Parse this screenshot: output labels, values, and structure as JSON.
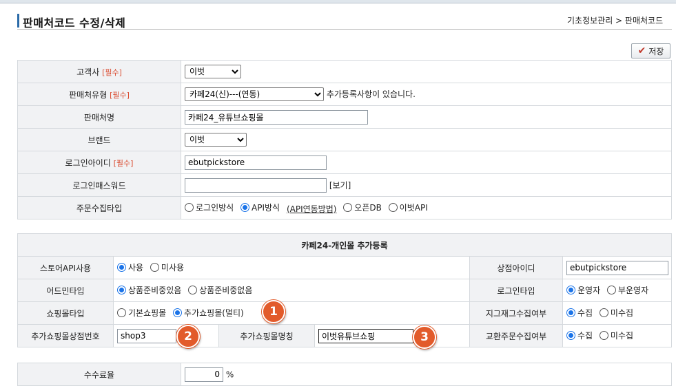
{
  "header": {
    "title": "판매처코드 수정/삭제",
    "breadcrumb": "기초정보관리 > 판매처코드"
  },
  "toolbar": {
    "save_label": "저장"
  },
  "required_tag": "[필수]",
  "form": {
    "customer_label": "고객사",
    "customer_value": "이벗",
    "channel_type_label": "판매처유형",
    "channel_type_value": "카페24(신)---(연동)",
    "channel_type_note": "추가등록사항이 있습니다.",
    "channel_name_label": "판매처명",
    "channel_name_value": "카페24_유튜브쇼핑몰",
    "brand_label": "브랜드",
    "brand_value": "이벗",
    "login_id_label": "로그인아이디",
    "login_id_value": "ebutpickstore",
    "login_pw_label": "로그인패스워드",
    "login_pw_value": "",
    "view_label": "[보기]",
    "order_type_label": "주문수집타입",
    "order_type_options": [
      "로그인방식",
      "API방식",
      "(API연동방법)",
      "오픈DB",
      "이벗API"
    ],
    "order_type_selected": "API방식"
  },
  "extra": {
    "section_title": "카페24-개인몰 추가등록",
    "store_api_label": "스토어API사용",
    "store_api_options": [
      "사용",
      "미사용"
    ],
    "store_api_selected": "사용",
    "shop_id_label": "상점아이디",
    "shop_id_value": "ebutpickstore",
    "admin_type_label": "어드민타입",
    "admin_type_options": [
      "상품준비중있음",
      "상품준비중없음"
    ],
    "admin_type_selected": "상품준비중있음",
    "login_type_label": "로그인타입",
    "login_type_options": [
      "운영자",
      "부운영자"
    ],
    "login_type_selected": "운영자",
    "mall_type_label": "쇼핑몰타입",
    "mall_type_options": [
      "기본쇼핑몰",
      "추가쇼핑몰(멀티)"
    ],
    "mall_type_selected": "추가쇼핑몰(멀티)",
    "stock_label": "지그재그수집여부",
    "stock_options": [
      "수집",
      "미수집"
    ],
    "stock_selected": "수집",
    "extra_shop_no_label": "추가쇼핑몰상점번호",
    "extra_shop_no_value": "shop3",
    "extra_shop_name_label": "추가쇼핑몰명칭",
    "extra_shop_name_value": "이벗유튜브쇼핑",
    "exchange_label": "교환주문수집여부",
    "exchange_options": [
      "수집",
      "미수집"
    ],
    "exchange_selected": "수집"
  },
  "fee": {
    "label": "수수료율",
    "value": "0",
    "unit": "%"
  },
  "markers": [
    "1",
    "2",
    "3"
  ],
  "colors": {
    "marker": "#e25b2b",
    "required": "#d9472b",
    "radio_selected": "#1a73e8"
  }
}
